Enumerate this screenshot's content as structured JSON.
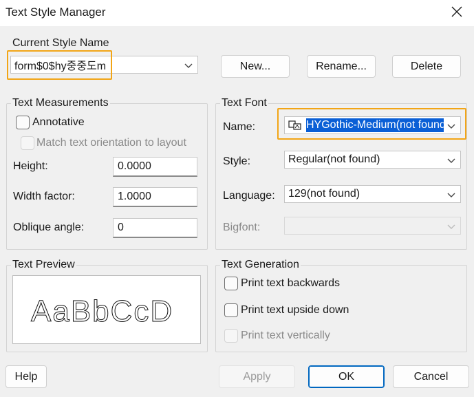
{
  "window": {
    "title": "Text Style Manager"
  },
  "current_style": {
    "legend": "Current Style Name",
    "value": "form$0$hy중중도m",
    "new_button": "New...",
    "rename_button": "Rename...",
    "delete_button": "Delete"
  },
  "measurements": {
    "legend": "Text Measurements",
    "annotative_label": "Annotative",
    "match_orientation_label": "Match text orientation to layout",
    "height_label": "Height:",
    "height_value": "0.0000",
    "width_factor_label": "Width factor:",
    "width_factor_value": "1.0000",
    "oblique_label": "Oblique angle:",
    "oblique_value": "0"
  },
  "font": {
    "legend": "Text Font",
    "name_label": "Name:",
    "name_value": "HYGothic-Medium(not found)",
    "style_label": "Style:",
    "style_value": "Regular(not found)",
    "language_label": "Language:",
    "language_value": "129(not found)",
    "bigfont_label": "Bigfont:",
    "bigfont_value": ""
  },
  "preview": {
    "legend": "Text Preview",
    "sample": "AaBbCcD"
  },
  "generation": {
    "legend": "Text Generation",
    "backwards_label": "Print text backwards",
    "upside_down_label": "Print text upside down",
    "vertical_label": "Print text vertically"
  },
  "footer": {
    "help": "Help",
    "apply": "Apply",
    "ok": "OK",
    "cancel": "Cancel"
  },
  "colors": {
    "highlight": "#f2a516",
    "selection": "#0a5fd6",
    "accent": "#0067c0"
  }
}
